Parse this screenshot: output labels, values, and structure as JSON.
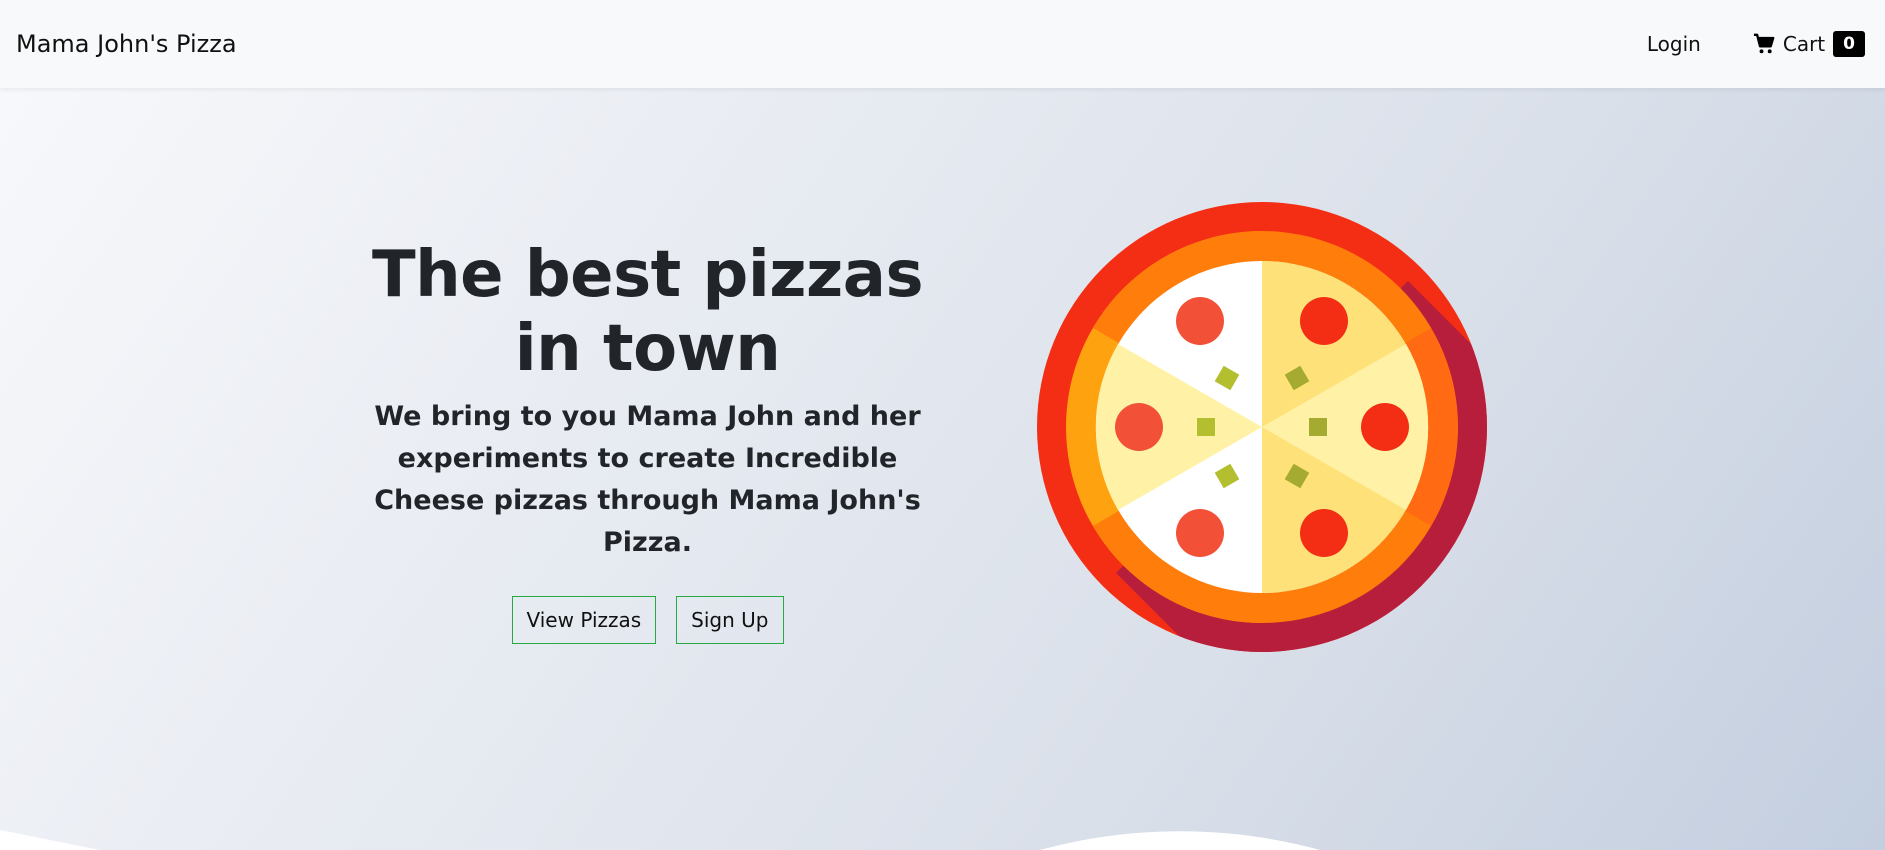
{
  "navbar": {
    "brand": "Mama John's Pizza",
    "login_label": "Login",
    "cart_label": "Cart",
    "cart_count": "0",
    "cart_icon": "shopping-cart-icon"
  },
  "hero": {
    "title": "The best pizzas in town",
    "subtitle": "We bring to you Mama John and her experiments to create Incredible Cheese pizzas through Mama John's Pizza.",
    "view_pizzas_label": "View Pizzas",
    "sign_up_label": "Sign Up",
    "illustration_icon": "pizza-icon"
  },
  "colors": {
    "button_border": "#28a745",
    "cart_badge_bg": "#000000",
    "navbar_bg": "#f8f9fa",
    "pizza_outer": "#f42e14",
    "pizza_shadow": "#b71e3c",
    "crust": "#ff7d0a",
    "cheese_light": "#fff2a6",
    "cheese_dark": "#ffe17a",
    "pepperoni": "#f25138",
    "olive": "#b3bf2e"
  }
}
